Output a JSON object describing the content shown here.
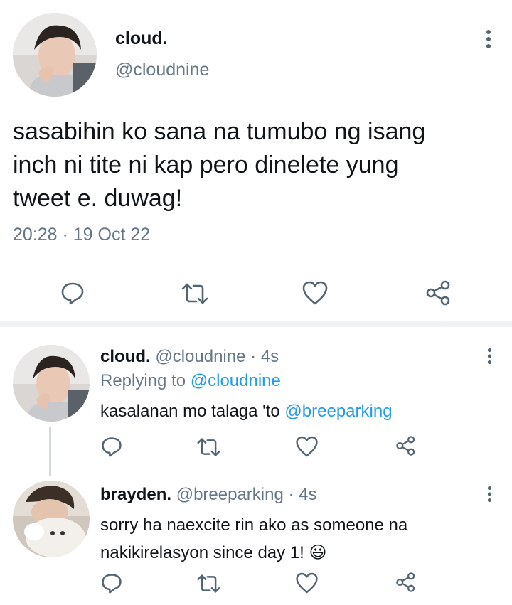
{
  "main_tweet": {
    "display_name": "cloud.",
    "handle": "@cloudnine",
    "text_lines": [
      "sasabihin ko sana na tumubo ng isang",
      "inch ni tite ni kap pero dinelete yung",
      "tweet e. duwag!"
    ],
    "timestamp": "20:28 · 19 Oct 22"
  },
  "reply1": {
    "display_name": "cloud.",
    "handle": "@cloudnine · 4s",
    "replying_prefix": "Replying to",
    "replying_to": "@cloudnine",
    "text_prefix": "kasalanan mo talaga 'to",
    "mention": "@breeparking"
  },
  "reply2": {
    "display_name": "brayden.",
    "handle": "@breeparking · 4s",
    "text_lines": [
      "sorry ha naexcite rin ako as someone na",
      "nakikirelasyon since day 1!"
    ],
    "emoji": "😃"
  },
  "icons": {
    "reply": "reply-icon",
    "retweet": "retweet-icon",
    "like": "heart-icon",
    "share": "share-icon",
    "more": "more-vertical-icon"
  },
  "colors": {
    "text": "#0f1419",
    "secondary": "#657786",
    "link": "#1d9bf0",
    "divider": "#e1e8ed",
    "section_gap": "#eff3f4"
  }
}
